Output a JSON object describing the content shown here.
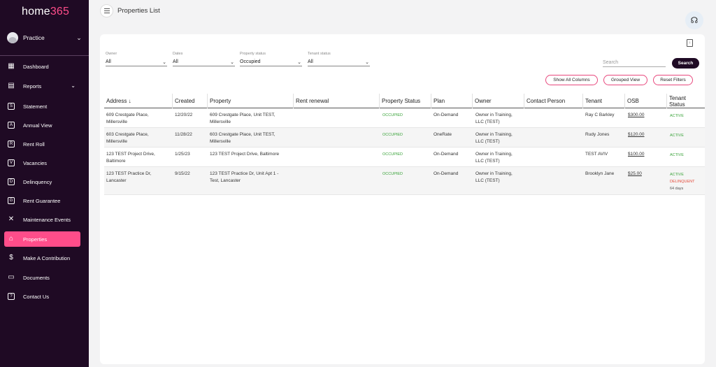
{
  "app": {
    "logo_home": "home",
    "logo_num": "365",
    "practice": "Practice"
  },
  "nav": [
    {
      "label": "Dashboard",
      "icon": "dashboard-icon",
      "glyph": "▦"
    },
    {
      "label": "Reports",
      "icon": "reports-icon",
      "glyph": "▤"
    },
    {
      "label": "Statement",
      "icon": "statement-icon",
      "glyph": "S"
    },
    {
      "label": "Annual View",
      "icon": "annual-view-icon",
      "glyph": "A"
    },
    {
      "label": "Rent Roll",
      "icon": "rent-roll-icon",
      "glyph": "R"
    },
    {
      "label": "Vacancies",
      "icon": "vacancies-icon",
      "glyph": "V"
    },
    {
      "label": "Delinquency",
      "icon": "delinquency-icon",
      "glyph": "D"
    },
    {
      "label": "Rent Guarantee",
      "icon": "rent-guarantee-icon",
      "glyph": "G"
    },
    {
      "label": "Maintenance Events",
      "icon": "tools-icon",
      "glyph": "✕"
    },
    {
      "label": "Properties",
      "icon": "properties-icon",
      "glyph": "⌂"
    },
    {
      "label": "Make A Contribution",
      "icon": "dollar-icon",
      "glyph": "$"
    },
    {
      "label": "Documents",
      "icon": "folder-icon",
      "glyph": "▭"
    },
    {
      "label": "Contact Us",
      "icon": "chat-icon",
      "glyph": "?"
    }
  ],
  "header": {
    "title": "Properties List"
  },
  "filters": [
    {
      "label": "Owner",
      "value": "All"
    },
    {
      "label": "Dates",
      "value": "All"
    },
    {
      "label": "Property status",
      "value": "Occupied"
    },
    {
      "label": "Tenant status",
      "value": "All"
    }
  ],
  "search": {
    "placeholder": "Search",
    "button": "Search"
  },
  "actions": {
    "show_all_columns": "Show All Columns",
    "grouped_view": "Grouped View",
    "reset_filters": "Reset Filters"
  },
  "table": {
    "columns": [
      "Address ↓",
      "Created",
      "Property",
      "Rent renewal",
      "Property Status",
      "Plan",
      "Owner",
      "Contact Person",
      "Tenant",
      "OSB",
      "Tenant",
      "Status"
    ],
    "rows": [
      {
        "address1": "609 Crestgate Place,",
        "address2": "Millersville",
        "created": "12/20/22",
        "property1": "609 Crestgate Place, Unit TEST,",
        "property2": "Millersville",
        "status": "OCCUPIED",
        "plan": "On-Demand",
        "owner1": "Owner in Training,",
        "owner2": "LLC (TEST)",
        "tenant": "Ray C Barkley",
        "osb": "$300.00",
        "tstatus": "ACTIVE",
        "tdelinquent": "",
        "tdays": ""
      },
      {
        "address1": "603 Crestgate Place,",
        "address2": "Millersville",
        "created": "11/28/22",
        "property1": "603 Crestgate Place, Unit TEST,",
        "property2": "Millersville",
        "status": "OCCUPIED",
        "plan": "OneRate",
        "owner1": "Owner in Training,",
        "owner2": "LLC (TEST)",
        "tenant": "Rudy  Jones",
        "osb": "$120.00",
        "tstatus": "ACTIVE",
        "tdelinquent": "",
        "tdays": ""
      },
      {
        "address1": "123 TEST Project Drive,",
        "address2": "Baltimore",
        "created": "1/25/23",
        "property1": "123 TEST Project Drive, Baltimore",
        "property2": "",
        "status": "OCCUPIED",
        "plan": "On-Demand",
        "owner1": "Owner in Training,",
        "owner2": "LLC (TEST)",
        "tenant": "TEST  AVIV",
        "osb": "$100.00",
        "tstatus": "ACTIVE",
        "tdelinquent": "",
        "tdays": ""
      },
      {
        "address1": "123 TEST Practice Dr,",
        "address2": "Lancaster",
        "created": "9/15/22",
        "property1": "123 TEST Practice Dr, Unit Apt 1 -",
        "property2": "Test, Lancaster",
        "status": "OCCUPIED",
        "plan": "On-Demand",
        "owner1": "Owner in Training,",
        "owner2": "LLC (TEST)",
        "tenant": "Brooklyn Jane",
        "osb": "$25.00",
        "tstatus": "ACTIVE",
        "tdelinquent": "DELINQUENT",
        "tdays": "64 days"
      }
    ]
  },
  "colors": {
    "sidebar_bg": "#1f0a24",
    "accent": "#ff4d8a",
    "status_green": "#3aa33a",
    "status_red": "#e34a3a"
  }
}
